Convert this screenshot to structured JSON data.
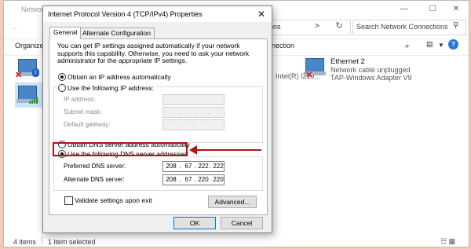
{
  "explorer": {
    "title": "Network Connections",
    "address_crumb": "ons",
    "address_chevron": ">",
    "search_placeholder": "Search Network Connections",
    "toolbar_organize": "Organize",
    "toolbar_connection": "nnection",
    "toolbar_more": "»",
    "partial_adapter_name": "Intel(R) I219...",
    "adapters": [
      {
        "name": "Ethernet 2",
        "status": "Network cable unplugged",
        "device": "TAP-Windows Adapter V9"
      }
    ],
    "status_items": "4 items",
    "status_selected": "1 item selected"
  },
  "dialog": {
    "title": "Internet Protocol Version 4 (TCP/IPv4) Properties",
    "tabs": [
      {
        "label": "General",
        "active": true
      },
      {
        "label": "Alternate Configuration",
        "active": false
      }
    ],
    "description": "You can get IP settings assigned automatically if your network supports this capability. Otherwise, you need to ask your network administrator for the appropriate IP settings.",
    "ip_auto_label": "Obtain an IP address automatically",
    "ip_manual_label": "Use the following IP address:",
    "ip_fields": {
      "ip_address": "IP address:",
      "subnet_mask": "Subnet mask:",
      "default_gateway": "Default gateway:"
    },
    "dns_auto_label": "Obtain DNS server address automatically",
    "dns_manual_label": "Use the following DNS server addresses:",
    "preferred_dns_label": "Preferred DNS server:",
    "preferred_dns": [
      "208",
      "67",
      "222",
      "222"
    ],
    "alternate_dns_label": "Alternate DNS server:",
    "alternate_dns": [
      "208",
      "67",
      "220",
      "220"
    ],
    "validate_label": "Validate settings upon exit",
    "advanced_label": "Advanced...",
    "ok_label": "OK",
    "cancel_label": "Cancel",
    "dot_char": "."
  },
  "colors": {
    "highlight": "#b1151a",
    "accent": "#0078d7"
  }
}
